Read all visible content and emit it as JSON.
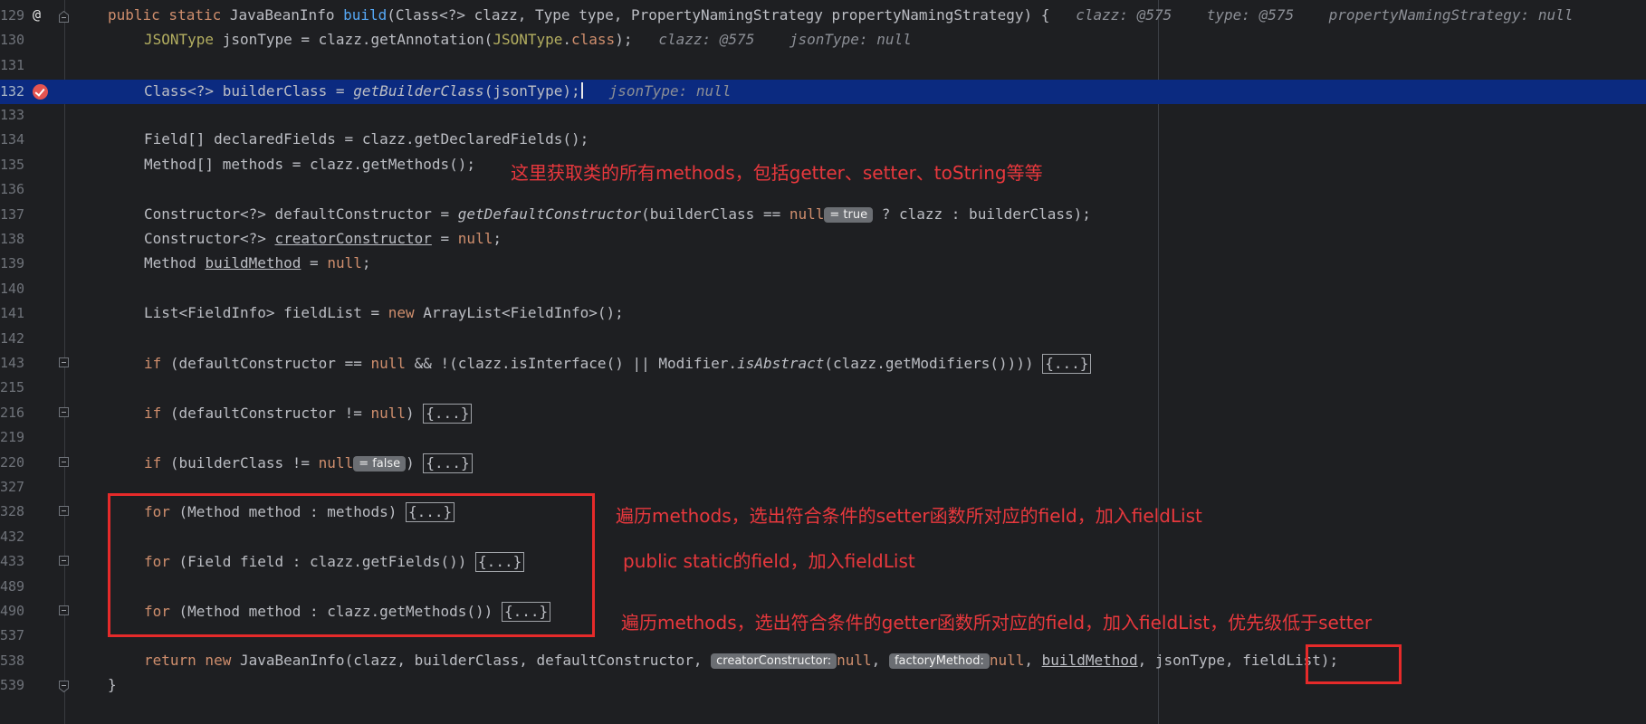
{
  "editor": {
    "lines": [
      {
        "num": "129",
        "text": "public static JavaBeanInfo build(Class<?> clazz, Type type, PropertyNamingStrategy propertyNamingStrategy) {"
      },
      {
        "num": "130",
        "text": "JSONType jsonType = clazz.getAnnotation(JSONType.class);"
      },
      {
        "num": "131",
        "text": ""
      },
      {
        "num": "132",
        "text": "Class<?> builderClass = getBuilderClass(jsonType);"
      },
      {
        "num": "133",
        "text": ""
      },
      {
        "num": "134",
        "text": "Field[] declaredFields = clazz.getDeclaredFields();"
      },
      {
        "num": "135",
        "text": "Method[] methods = clazz.getMethods();"
      },
      {
        "num": "136",
        "text": ""
      },
      {
        "num": "137",
        "text": "Constructor<?> defaultConstructor = getDefaultConstructor(builderClass == null ? clazz : builderClass);"
      },
      {
        "num": "138",
        "text": "Constructor<?> creatorConstructor = null;"
      },
      {
        "num": "139",
        "text": "Method buildMethod = null;"
      },
      {
        "num": "140",
        "text": ""
      },
      {
        "num": "141",
        "text": "List<FieldInfo> fieldList = new ArrayList<FieldInfo>();"
      },
      {
        "num": "142",
        "text": ""
      },
      {
        "num": "143",
        "text": "if (defaultConstructor == null && !(clazz.isInterface() || Modifier.isAbstract(clazz.getModifiers()))) {...}"
      },
      {
        "num": "215",
        "text": ""
      },
      {
        "num": "216",
        "text": "if (defaultConstructor != null) {...}"
      },
      {
        "num": "219",
        "text": ""
      },
      {
        "num": "220",
        "text": "if (builderClass != null) {...}"
      },
      {
        "num": "327",
        "text": ""
      },
      {
        "num": "328",
        "text": "for (Method method : methods) {...}"
      },
      {
        "num": "432",
        "text": ""
      },
      {
        "num": "433",
        "text": "for (Field field : clazz.getFields()) {...}"
      },
      {
        "num": "489",
        "text": ""
      },
      {
        "num": "490",
        "text": "for (Method method : clazz.getMethods()) {...}"
      },
      {
        "num": "537",
        "text": ""
      },
      {
        "num": "538",
        "text": "return new JavaBeanInfo(clazz, builderClass, defaultConstructor, null, null, buildMethod, jsonType, fieldList);"
      },
      {
        "num": "539",
        "text": "}"
      }
    ],
    "current_line": "132",
    "inline_hints": {
      "l129": [
        "clazz: @575",
        "type: @575",
        "propertyNamingStrategy: null"
      ],
      "l130": [
        "clazz: @575",
        "jsonType: null"
      ],
      "l132": [
        "jsonType: null"
      ],
      "l137_pill": "= true",
      "l220_pill": "= false",
      "l538_param1": "creatorConstructor:",
      "l538_param2": "factoryMethod:"
    },
    "folded_block": "{...}"
  },
  "annotations": {
    "note_methods": "这里获取类的所有methods，包括getter、setter、toString等等",
    "note_setter": "遍历methods，选出符合条件的setter函数所对应的field，加入fieldList",
    "note_public_static": "public static的field，加入fieldList",
    "note_getter": "遍历methods，选出符合条件的getter函数所对应的field，加入fieldList，优先级低于setter"
  },
  "colors": {
    "background": "#1e1f22",
    "current_line": "#0b2a80",
    "keyword": "#cf8e6d",
    "annotation_red": "#e8383d",
    "box_red": "#e62a2a"
  }
}
